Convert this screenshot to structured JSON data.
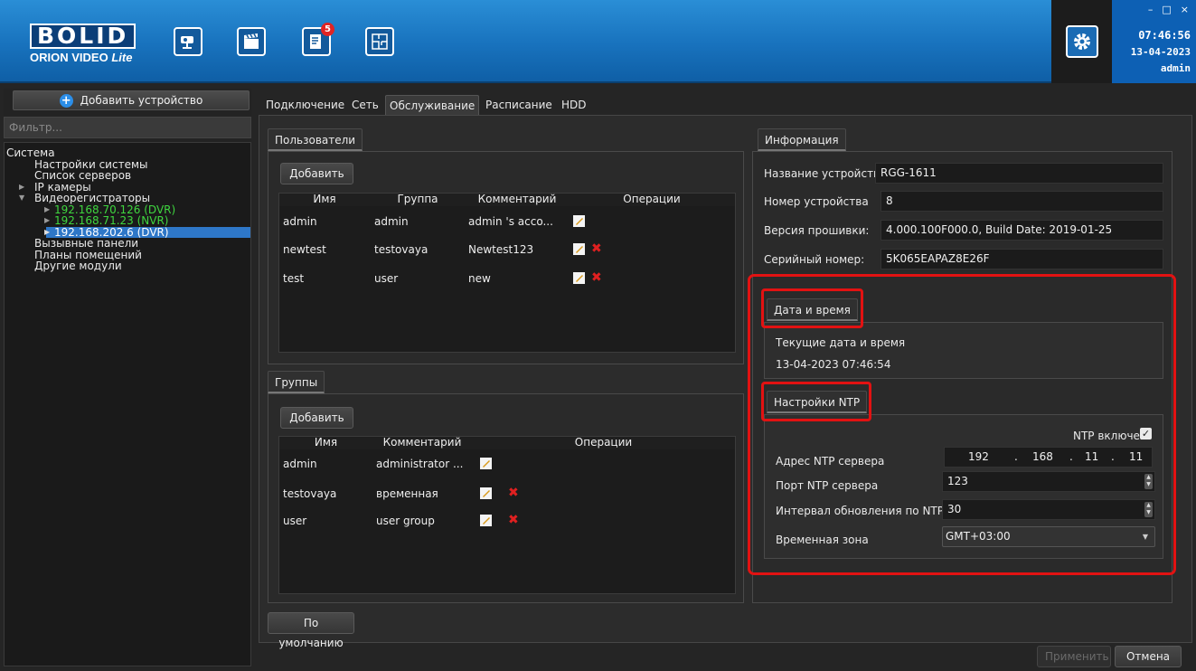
{
  "app": {
    "logo_main": "BOLID",
    "logo_sub": "ORION VIDEO",
    "logo_sub_italic": "Lite"
  },
  "toolbar": {
    "badge_count": "5",
    "icons": [
      "camera-icon",
      "clapperboard-icon",
      "report-icon",
      "plan-icon"
    ]
  },
  "clock": {
    "time": "07:46:56",
    "date": "13-04-2023",
    "user": "admin"
  },
  "window_controls": {
    "minimize": "–",
    "maximize": "□",
    "close": "×"
  },
  "sidebar": {
    "add_device": "Добавить устройство",
    "filter_placeholder": "Фильтр...",
    "tree": {
      "root": "Система",
      "items": [
        "Настройки системы",
        "Список серверов",
        "IP камеры",
        "Видеорегистраторы"
      ],
      "recorders": [
        "192.168.70.126 (DVR)",
        "192.168.71.23 (NVR)",
        "192.168.202.6 (DVR)"
      ],
      "items_after": [
        "Вызывные панели",
        "Планы помещений",
        "Другие модули"
      ]
    }
  },
  "tabs": [
    "Подключение",
    "Сеть",
    "Обслуживание",
    "Расписание",
    "HDD"
  ],
  "users": {
    "title": "Пользователи",
    "add": "Добавить",
    "headers": [
      "Имя",
      "Группа",
      "Комментарий",
      "Операции"
    ],
    "rows": [
      {
        "name": "admin",
        "group": "admin",
        "comment": "admin 's acco..."
      },
      {
        "name": "newtest",
        "group": "testovaya",
        "comment": "Newtest123"
      },
      {
        "name": "test",
        "group": "user",
        "comment": "new"
      }
    ]
  },
  "groups": {
    "title": "Группы",
    "add": "Добавить",
    "headers": [
      "Имя",
      "Комментарий",
      "Операции"
    ],
    "rows": [
      {
        "name": "admin",
        "comment": "administrator ..."
      },
      {
        "name": "testovaya",
        "comment": "временная"
      },
      {
        "name": "user",
        "comment": "user group"
      }
    ]
  },
  "defaults_button": "По умолчанию",
  "info": {
    "title": "Информация",
    "device_name_label": "Название устройства",
    "device_name": "RGG-1611",
    "device_number_label": "Номер устройства",
    "device_number": "8",
    "firmware_label": "Версия прошивки:",
    "firmware": "4.000.100F000.0, Build Date: 2019-01-25",
    "serial_label": "Серийный номер:",
    "serial": "5K065EAPAZ8E26F"
  },
  "datetime": {
    "title": "Дата и время",
    "current_label": "Текущие дата и время",
    "current_value": "13-04-2023 07:46:54"
  },
  "ntp": {
    "title": "Настройки NTP",
    "enabled_label": "NTP включен",
    "server_label": "Адрес NTP сервера",
    "ip": [
      "192",
      "168",
      "11",
      "11"
    ],
    "port_label": "Порт NTP сервера",
    "port": "123",
    "interval_label": "Интервал обновления по NTP",
    "interval": "30",
    "timezone_label": "Временная зона",
    "timezone": "GMT+03:00"
  },
  "footer": {
    "apply": "Применить",
    "cancel": "Отмена"
  },
  "colors": {
    "header": "#1872bd",
    "highlight": "#e21212",
    "selected": "#2e77c8",
    "online": "#3fd63f"
  }
}
